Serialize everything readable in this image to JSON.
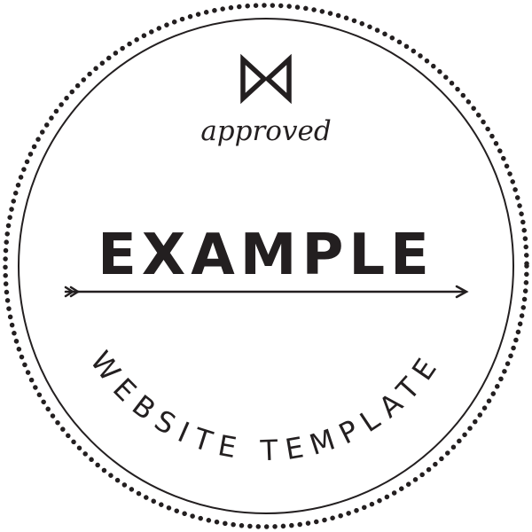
{
  "badge": {
    "tagline": "approved",
    "title": "EXAMPLE",
    "subtitle": "WEBSITE TEMPLATE",
    "ink_color": "#231f20",
    "background_color": "#ffffff",
    "emblem_icon": "bowtie-icon",
    "divider_icon": "arrow-right-icon"
  }
}
